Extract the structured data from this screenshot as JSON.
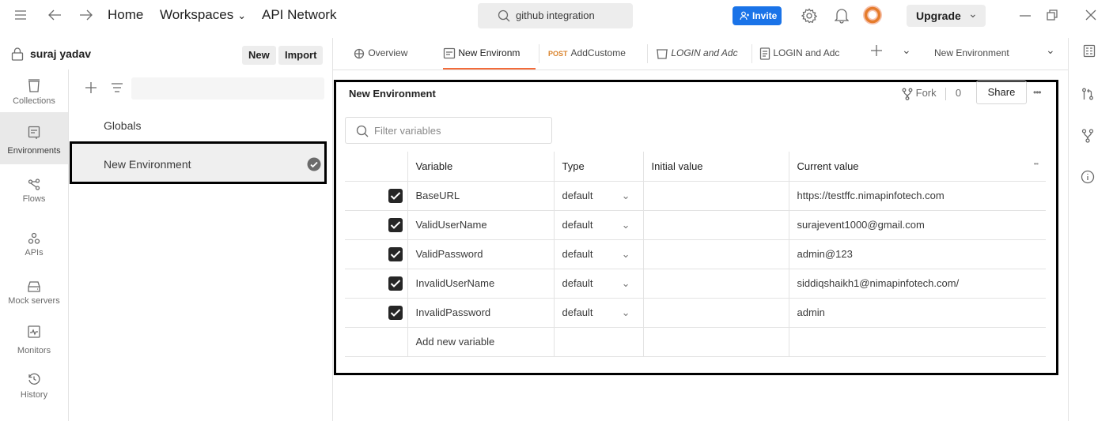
{
  "topbar": {
    "home": "Home",
    "workspaces": "Workspaces",
    "api_network": "API Network",
    "search_text": "github integration",
    "invite": "Invite",
    "upgrade": "Upgrade"
  },
  "workspace": {
    "name": "suraj yadav",
    "new_label": "New",
    "import_label": "Import"
  },
  "sidebar": {
    "items": [
      {
        "label": "Collections",
        "icon": "collections-icon"
      },
      {
        "label": "Environments",
        "icon": "environments-icon"
      },
      {
        "label": "Flows",
        "icon": "flows-icon"
      },
      {
        "label": "APIs",
        "icon": "apis-icon"
      },
      {
        "label": "Mock servers",
        "icon": "mock-servers-icon"
      },
      {
        "label": "Monitors",
        "icon": "monitors-icon"
      },
      {
        "label": "History",
        "icon": "history-icon"
      }
    ]
  },
  "env_list": {
    "globals": "Globals",
    "items": [
      "New Environment"
    ]
  },
  "tabs": {
    "items": [
      {
        "label": "Overview"
      },
      {
        "label": "New Environm"
      },
      {
        "method": "POST",
        "label": "AddCustome"
      },
      {
        "label": "LOGIN and Adc"
      },
      {
        "label": "LOGIN and Adc"
      }
    ],
    "env_selector": "New Environment"
  },
  "environment": {
    "title": "New Environment",
    "fork_label": "Fork",
    "fork_count": "0",
    "share_label": "Share",
    "filter_placeholder": "Filter variables",
    "columns": {
      "variable": "Variable",
      "type": "Type",
      "initial": "Initial value",
      "current": "Current value"
    },
    "rows": [
      {
        "variable": "BaseURL",
        "type": "default",
        "initial": "",
        "current": "https://testffc.nimapinfotech.com",
        "checked": true
      },
      {
        "variable": "ValidUserName",
        "type": "default",
        "initial": "",
        "current": "surajevent1000@gmail.com",
        "checked": true
      },
      {
        "variable": "ValidPassword",
        "type": "default",
        "initial": "",
        "current": "admin@123",
        "checked": true
      },
      {
        "variable": "InvalidUserName",
        "type": "default",
        "initial": "",
        "current": "siddiqshaikh1@nimapinfotech.com/",
        "checked": true
      },
      {
        "variable": "InvalidPassword",
        "type": "default",
        "initial": "",
        "current": "admin",
        "checked": true
      }
    ],
    "add_placeholder": "Add new variable"
  }
}
